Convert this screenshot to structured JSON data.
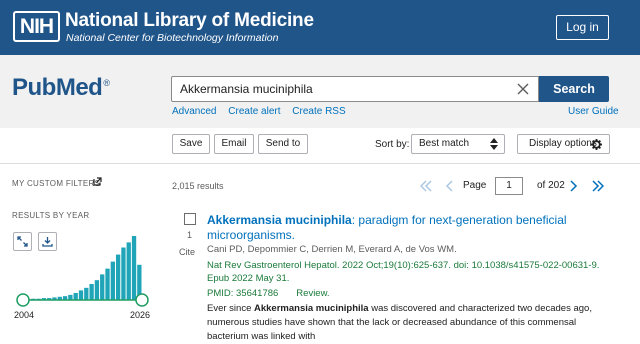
{
  "header": {
    "logo": "NIH",
    "title": "National Library of Medicine",
    "subtitle": "National Center for Biotechnology Information",
    "login": "Log in"
  },
  "search": {
    "logo": "PubMed",
    "logo_reg": "®",
    "query": "Akkermansia muciniphila",
    "button": "Search",
    "links": [
      "Advanced",
      "Create alert",
      "Create RSS"
    ],
    "user_guide": "User Guide"
  },
  "actions": {
    "save": "Save",
    "email": "Email",
    "send_to": "Send to",
    "sort_by_label": "Sort by:",
    "sort_value": "Best match",
    "display_options": "Display options"
  },
  "sidebar": {
    "custom_filters": "MY CUSTOM FILTERS",
    "results_by_year": "RESULTS BY YEAR",
    "year_start": "2004",
    "year_end": "2026",
    "year_bars": [
      0.01,
      0.01,
      0.02,
      0.02,
      0.03,
      0.03,
      0.04,
      0.05,
      0.06,
      0.08,
      0.11,
      0.15,
      0.19,
      0.25,
      0.31,
      0.4,
      0.49,
      0.6,
      0.71,
      0.82,
      0.9,
      1.0,
      0.55
    ]
  },
  "results": {
    "count": "2,015 results",
    "page_label": "Page",
    "page": "1",
    "page_of": "of 202"
  },
  "result": {
    "number": "1",
    "cite": "Cite",
    "title_bold": "Akkermansia muciniphila",
    "title_rest": ": paradigm for next-generation beneficial microorganisms.",
    "authors": "Cani PD, Depommier C, Derrien M, Everard A, de Vos WM.",
    "journal": "Nat Rev Gastroenterol Hepatol. 2022 Oct;19(10):625-637. doi: 10.1038/s41575-022-00631-9. Epub 2022 May 31.",
    "pmid": "PMID: 35641786",
    "type": "Review.",
    "snippet_pre": "Ever since ",
    "snippet_bold": "Akkermansia muciniphila",
    "snippet_post": " was discovered and characterized two decades ago, numerous studies have shown that the lack or decreased abundance of this commensal bacterium was linked with"
  },
  "colors": {
    "brand": "#20558a",
    "link": "#0071bc",
    "journal": "#1a7a3a",
    "bar": "#20a5b8"
  }
}
